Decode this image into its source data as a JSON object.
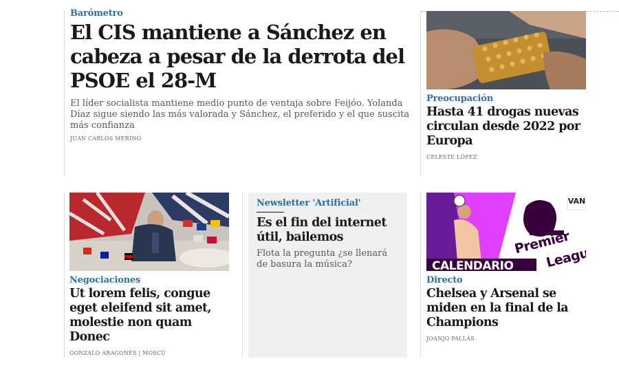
{
  "top_story": {
    "kicker": "Barómetro",
    "headline": "El CIS mantiene a Sánchez en cabeza a pesar de la derrota del PSOE el 28-M",
    "dek": "El líder socialista mantiene medio punto de ventaja sobre Feijóo. Yolanda Díaz sigue siendo las más valorada y Sánchez, el preferido y el que suscita más confianza",
    "byline": "JUAN CARLOS MERINO"
  },
  "side_story": {
    "kicker": "Preocupación",
    "headline": "Hasta 41 drogas nuevas circulan desde 2022 por Europa",
    "byline": "CELESTE LÓPEZ",
    "image_icon": "pills-photo"
  },
  "story_negociaciones": {
    "kicker": "Negociaciones",
    "headline": "Ut lorem felis, congue eget eleifend sit amet, molestie non quam Donec",
    "byline": "GONZALO ARAGONÉS | MOSCÚ",
    "image_icon": "diplomats-flags-photo"
  },
  "newsletter": {
    "kicker": "Newsletter 'Artificial'",
    "headline": "Es el fin del internet útil, bailemos",
    "dek": "Flota la pregunta ¿se llenará de basura la música?"
  },
  "story_directo": {
    "kicker": "Directo",
    "headline": "Chelsea y Arsenal se miden en la final de la Champions",
    "byline": "JOANJO PALLÀS",
    "image_icon": "premier-league-photo",
    "image_text": {
      "calendar": "CALENDARIO",
      "premier": "Premier",
      "league": "League",
      "corner": "VAN"
    }
  }
}
